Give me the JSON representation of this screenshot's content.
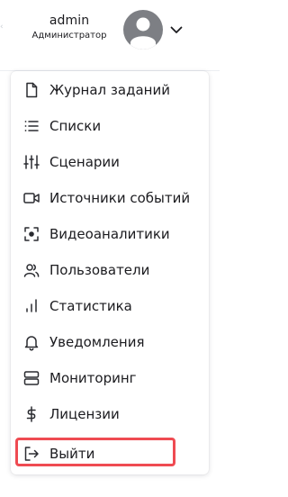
{
  "header": {
    "username": "admin",
    "role": "Администратор"
  },
  "menu": {
    "items": [
      {
        "label": "Журнал заданий",
        "icon": "document-icon"
      },
      {
        "label": "Списки",
        "icon": "list-icon"
      },
      {
        "label": "Сценарии",
        "icon": "sliders-icon"
      },
      {
        "label": "Источники событий",
        "icon": "video-camera-icon"
      },
      {
        "label": "Видеоаналитики",
        "icon": "focus-frame-icon"
      },
      {
        "label": "Пользователи",
        "icon": "users-icon"
      },
      {
        "label": "Статистика",
        "icon": "bar-chart-icon"
      },
      {
        "label": "Уведомления",
        "icon": "bell-icon"
      },
      {
        "label": "Мониторинг",
        "icon": "server-icon"
      },
      {
        "label": "Лицензии",
        "icon": "dollar-icon"
      },
      {
        "label": "Выйти",
        "icon": "logout-icon"
      }
    ],
    "highlighted_item": "Выйти",
    "highlight_color": "#ef4b52"
  }
}
